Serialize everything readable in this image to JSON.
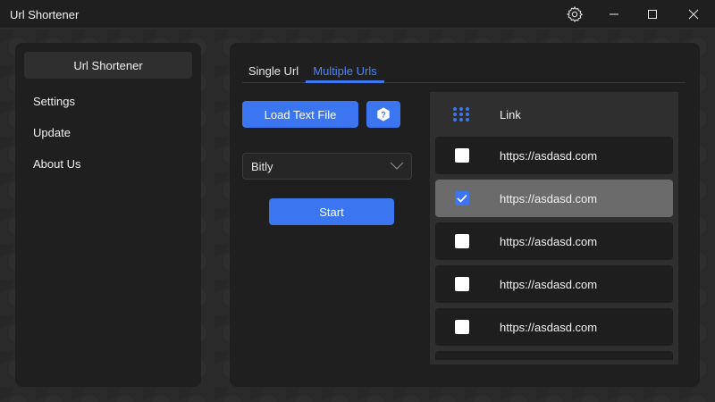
{
  "window": {
    "title": "Url Shortener"
  },
  "sidebar": {
    "items": [
      {
        "label": "Url Shortener",
        "active": true
      },
      {
        "label": "Settings",
        "active": false
      },
      {
        "label": "Update",
        "active": false
      },
      {
        "label": "About Us",
        "active": false
      }
    ]
  },
  "tabs": [
    {
      "label": "Single Url",
      "active": false
    },
    {
      "label": "Multiple Urls",
      "active": true
    }
  ],
  "controls": {
    "load_label": "Load Text File",
    "help_icon": "help-icon",
    "service_select": "Bitly",
    "start_label": "Start"
  },
  "list": {
    "header": "Link",
    "rows": [
      {
        "link": "https://asdasd.com",
        "checked": false
      },
      {
        "link": "https://asdasd.com",
        "checked": true
      },
      {
        "link": "https://asdasd.com",
        "checked": false
      },
      {
        "link": "https://asdasd.com",
        "checked": false
      },
      {
        "link": "https://asdasd.com",
        "checked": false
      }
    ]
  },
  "colors": {
    "accent": "#3b75ef",
    "tab_active": "#4a86f7",
    "panel": "#1f1f1f",
    "selected_row": "#6b6b6b"
  }
}
